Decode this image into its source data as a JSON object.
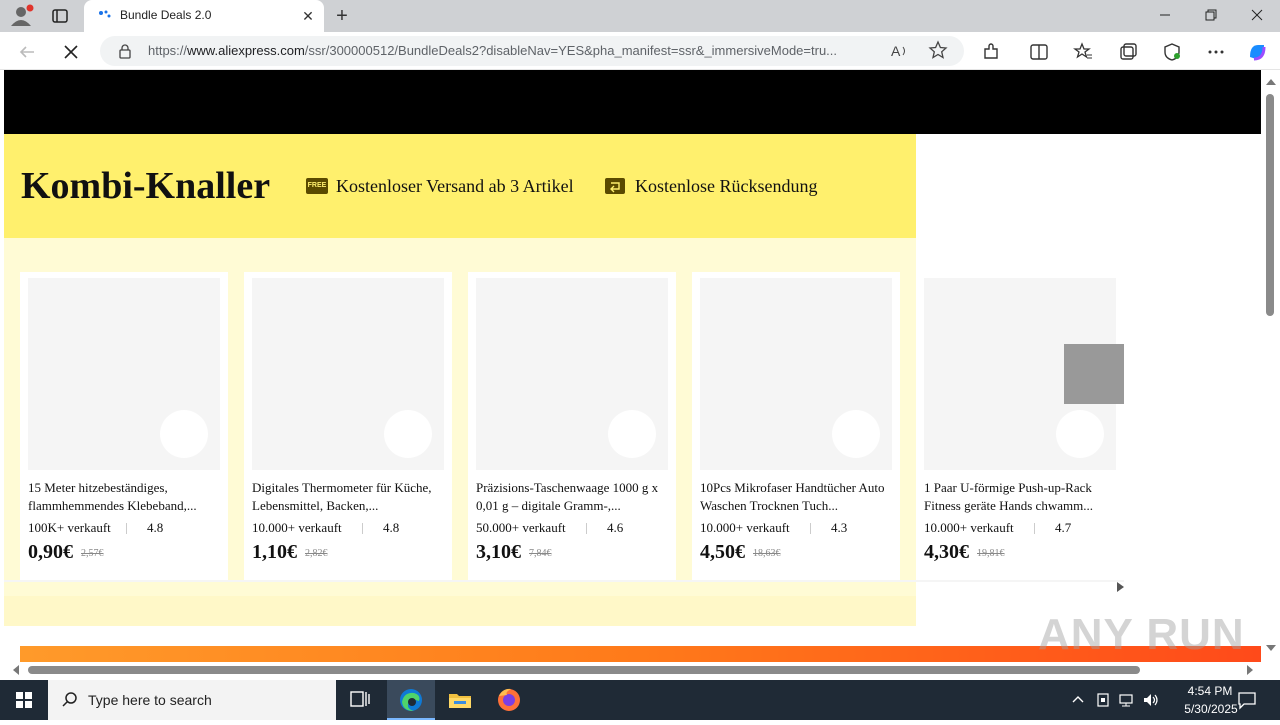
{
  "browser": {
    "tab_title": "Bundle Deals 2.0",
    "url_prefix": "https://",
    "url_domain": "www.aliexpress.com",
    "url_rest": "/ssr/300000512/BundleDeals2?disableNav=YES&pha_manifest=ssr&_immersiveMode=tru...",
    "tab_close": "✕",
    "new_tab": "+"
  },
  "banner": {
    "title": "Kombi-Knaller",
    "shipping_icon_text": "FREE",
    "shipping": "Kostenloser Versand ab 3 Artikel",
    "returns": "Kostenlose Rücksendung",
    "accent_color": "#fff06d"
  },
  "products": [
    {
      "title": "15 Meter hitzebeständiges, flammhemmendes Klebeband,...",
      "sold": "100K+ verkauft",
      "rating": "4.8",
      "price": "0,90€",
      "old_price": "2,57€"
    },
    {
      "title": "Digitales Thermometer für Küche, Lebensmittel, Backen,...",
      "sold": "10.000+ verkauft",
      "rating": "4.8",
      "price": "1,10€",
      "old_price": "2,82€"
    },
    {
      "title": "Präzisions-Taschenwaage 1000 g x 0,01 g – digitale Gramm-,...",
      "sold": "50.000+ verkauft",
      "rating": "4.6",
      "price": "3,10€",
      "old_price": "7,84€"
    },
    {
      "title": "10Pcs Mikrofaser Handtücher Auto Waschen Trocknen Tuch...",
      "sold": "10.000+ verkauft",
      "rating": "4.3",
      "price": "4,50€",
      "old_price": "18,63€"
    },
    {
      "title": "1 Paar U-förmige Push-up-Rack Fitness geräte Hands chwamm...",
      "sold": "10.000+ verkauft",
      "rating": "4.7",
      "price": "4,30€",
      "old_price": "19,81€"
    }
  ],
  "taskbar": {
    "search_placeholder": "Type here to search",
    "time": "4:54 PM",
    "date": "5/30/2025"
  },
  "watermark": "ANY RUN"
}
